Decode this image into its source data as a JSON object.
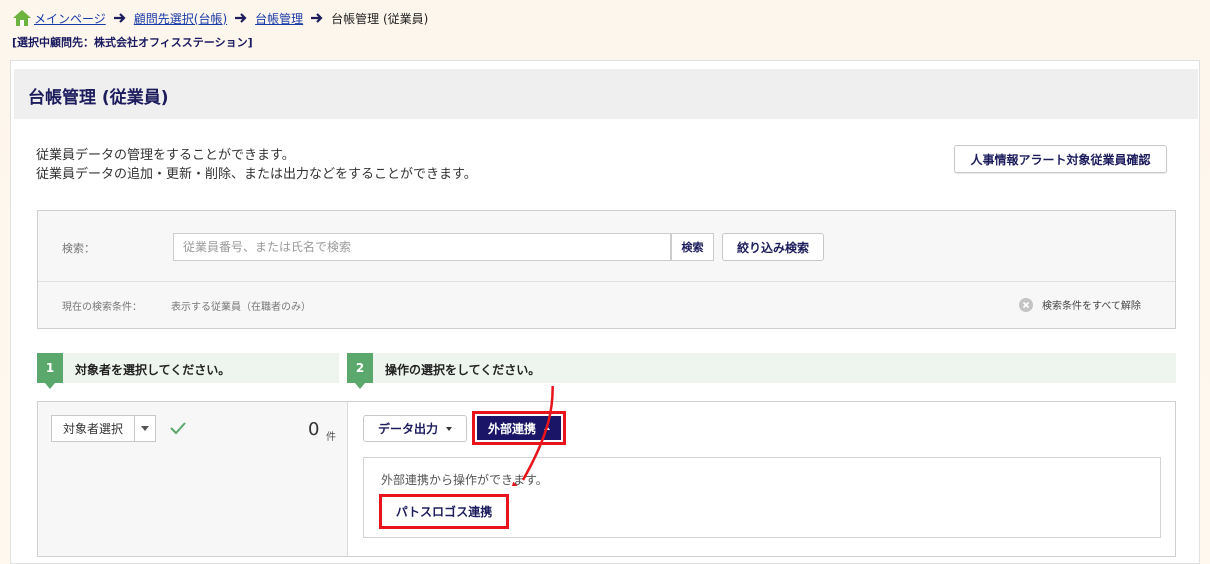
{
  "breadcrumb": {
    "items": [
      {
        "label": "メインページ"
      },
      {
        "label": "顧問先選択(台帳)"
      },
      {
        "label": "台帳管理"
      }
    ],
    "current": "台帳管理 (従業員)"
  },
  "selected_client": "[選択中顧問先：株式会社オフィスステーション]",
  "panel": {
    "title": "台帳管理 (従業員)",
    "desc_line1": "従業員データの管理をすることができます。",
    "desc_line2": "従業員データの追加・更新・削除、または出力などをすることができます。",
    "alert_button": "人事情報アラート対象従業員確認"
  },
  "search": {
    "label": "検索：",
    "placeholder": "従業員番号、または氏名で検索",
    "search_button": "検索",
    "filter_button": "絞り込み検索",
    "condition_label": "現在の検索条件：",
    "condition_value": "表示する従業員（在職者のみ）",
    "clear_label": "検索条件をすべて解除"
  },
  "steps": [
    {
      "num": "1",
      "text": "対象者を選択してください。"
    },
    {
      "num": "2",
      "text": "操作の選択をしてください。"
    }
  ],
  "target": {
    "select_label": "対象者選択",
    "count": "0",
    "unit": "件"
  },
  "ops": {
    "data_output": "データ出力",
    "external": "外部連携",
    "external_desc": "外部連携から操作ができます。",
    "paps": "パトスロゴス連携"
  },
  "colors": {
    "accent_navy": "#1a1566",
    "highlight_red": "#e8141b",
    "step_green": "#5aa86b"
  }
}
